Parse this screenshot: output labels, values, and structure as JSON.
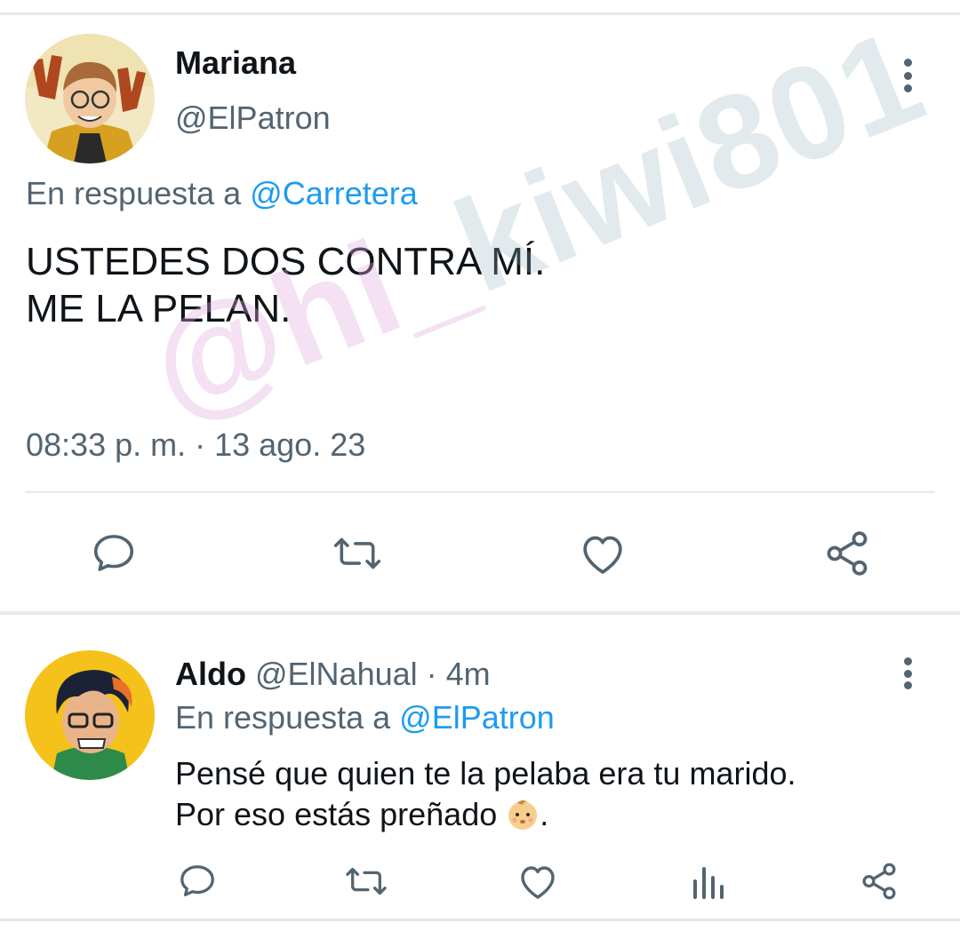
{
  "main_tweet": {
    "name": "Mariana",
    "handle": "@ElPatron",
    "reply_prefix": "En respuesta a",
    "reply_mention": "@Carretera",
    "text": "USTEDES DOS CONTRA MÍ.\nME LA PELAN.",
    "timestamp": "08:33 p. m. · 13 ago. 23"
  },
  "reply_tweet": {
    "name": "Aldo",
    "handle": "@ElNahual",
    "dot": " · ",
    "time": "4m",
    "reply_prefix": "En respuesta a",
    "reply_mention": "@ElPatron",
    "text_line1": "Pensé que quien te la pelaba era tu marido.",
    "text_line2_prefix": "Por eso estás preñado ",
    "text_line2_suffix": "."
  },
  "watermark": {
    "part1": "@hi_",
    "part2": "kiwi801"
  },
  "colors": {
    "text": "#0f1419",
    "secondary": "#536471",
    "link": "#1d9bf0"
  },
  "icons": {
    "reply": "reply-icon",
    "retweet": "retweet-icon",
    "like": "heart-icon",
    "share": "share-icon",
    "views": "views-icon",
    "more": "more-vertical-icon"
  }
}
